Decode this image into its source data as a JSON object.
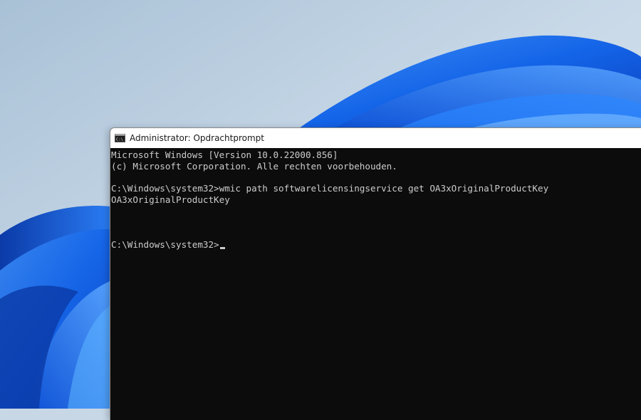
{
  "window": {
    "title": "Administrator: Opdrachtprompt",
    "icon": "cmd-icon"
  },
  "console": {
    "lines": [
      "Microsoft Windows [Version 10.0.22000.856]",
      "(c) Microsoft Corporation. Alle rechten voorbehouden.",
      "",
      "C:\\Windows\\system32>wmic path softwarelicensingservice get OA3xOriginalProductKey",
      "OA3xOriginalProductKey",
      "",
      "",
      ""
    ],
    "prompt": "C:\\Windows\\system32>"
  },
  "colors": {
    "console_bg": "#0c0c0c",
    "console_text": "#cccccc",
    "titlebar_bg": "#ffffff",
    "wallpaper_blue": "#1a6ff0"
  }
}
